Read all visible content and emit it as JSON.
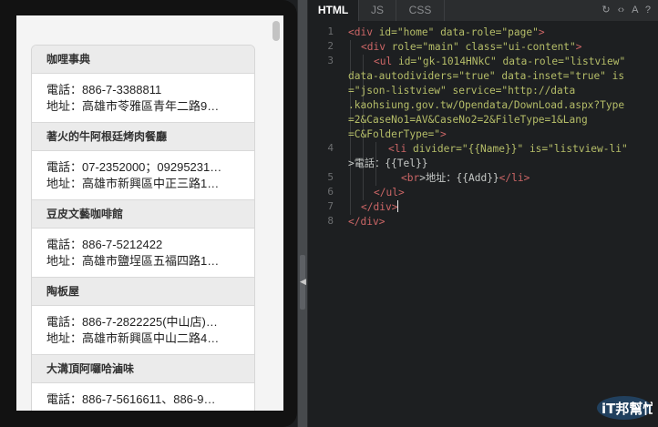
{
  "preview": {
    "entries": [
      {
        "name": "咖哩事典",
        "tel": "電話：886-7-3388811",
        "addr": "地址：高雄市苓雅區青年二路9…"
      },
      {
        "name": "著火的牛阿根廷烤肉餐廳",
        "tel": "電話：07-2352000；09295231…",
        "addr": "地址：高雄市新興區中正三路1…"
      },
      {
        "name": "豆皮文藝咖啡館",
        "tel": "電話：886-7-5212422",
        "addr": "地址：高雄市鹽埕區五福四路1…"
      },
      {
        "name": "陶板屋",
        "tel": "電話：886-7-2822225(中山店)…",
        "addr": "地址：高雄市新興區中山二路4…"
      },
      {
        "name": "大溝頂阿囉哈滷味",
        "tel": "電話：886-7-5616611、886-9…",
        "addr": ""
      }
    ]
  },
  "editor": {
    "tabs": [
      "HTML",
      "JS",
      "CSS"
    ],
    "active_tab": "HTML",
    "tools": [
      "↻",
      "‹›",
      "A",
      "?"
    ],
    "line_numbers": [
      "1",
      "2",
      "3",
      "4",
      "5",
      "6",
      "7",
      "8"
    ],
    "code": {
      "l1": [
        "<div",
        " id=",
        "\"home\"",
        " data-role=",
        "\"page\"",
        ">"
      ],
      "l2": [
        "<div",
        " role=",
        "\"main\"",
        " class=",
        "\"ui-content\"",
        ">"
      ],
      "l3a": [
        "<ul",
        " id=",
        "\"gk-1014HNkC\"",
        " data-role=",
        "\"listview\""
      ],
      "l3b": [
        "data-autodividers=",
        "\"true\"",
        " data-inset=",
        "\"true\"",
        " is"
      ],
      "l3c": [
        "=",
        "\"json-listview\"",
        " service=",
        "\"http://data"
      ],
      "l3d": [
        ".kaohsiung.gov.tw/Opendata/DownLoad.aspx?Type"
      ],
      "l3e": [
        "=2&CaseNo1=AV&CaseNo2=2&FileType=1&Lang"
      ],
      "l3f": [
        "=C&FolderType=",
        "\"",
        ">"
      ],
      "l4a": [
        "<li",
        " divider=",
        "\"{{Name}}\"",
        " is=",
        "\"listview-li\""
      ],
      "l4b": [
        ">電話：{{Tel}}"
      ],
      "l5": [
        "<br",
        ">地址：{{Add}}",
        "</li",
        ">"
      ],
      "l6": [
        "</ul",
        ">"
      ],
      "l7": [
        "</div",
        ">"
      ],
      "l8": [
        "</div",
        ">"
      ]
    }
  },
  "watermark": {
    "text": "iT邦幫忙",
    "color": "#2b7fd1"
  }
}
